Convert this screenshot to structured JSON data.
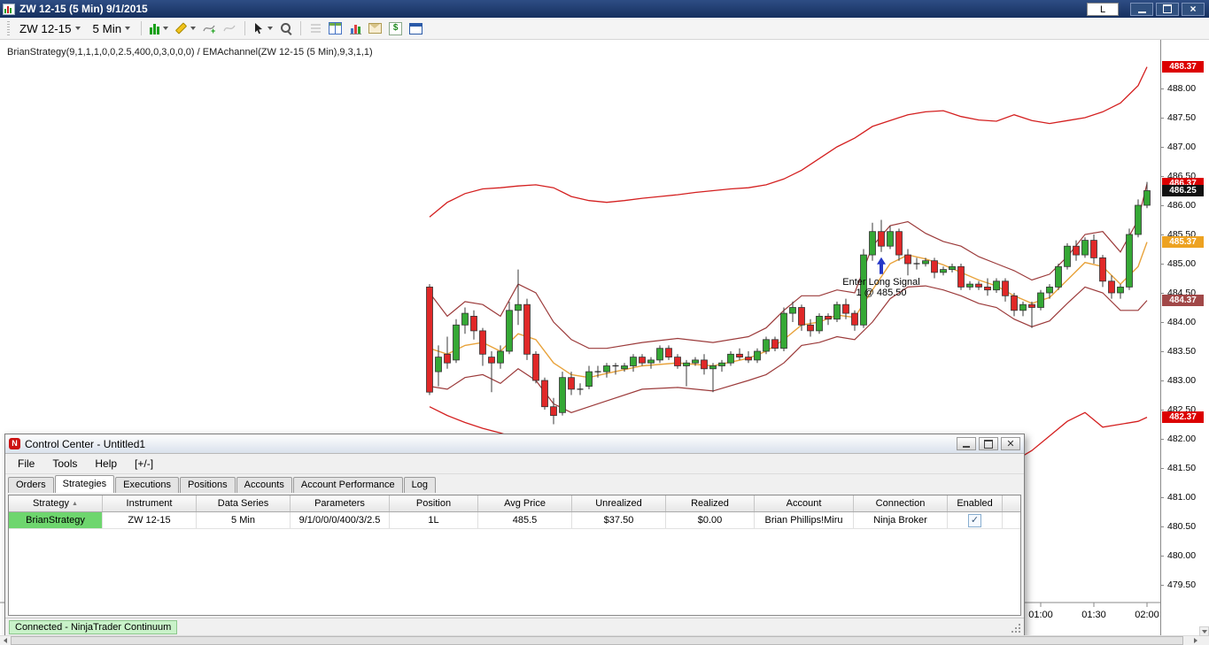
{
  "title_bar": {
    "title": "ZW 12-15 (5 Min)  9/1/2015",
    "link_button": "L"
  },
  "toolbar": {
    "instrument": "ZW 12-15",
    "interval": "5 Min"
  },
  "chart": {
    "indicator_label": "BrianStrategy(9,1,1,1,0,0,2.5,400,0,3,0,0,0) / EMAchannel(ZW 12-15 (5 Min),9,3,1,1)",
    "time_labels": [
      "01:00",
      "01:30",
      "02:00"
    ]
  },
  "chart_data": {
    "type": "candlestick",
    "instrument": "ZW 12-15",
    "interval": "5 Min",
    "price_axis": {
      "min": 479.5,
      "max": 488.0,
      "step": 0.5
    },
    "time_ticks": [
      {
        "label": "01:00",
        "bar": 69
      },
      {
        "label": "01:30",
        "bar": 75
      },
      {
        "label": "02:00",
        "bar": 81
      }
    ],
    "colors": {
      "up": "#35a835",
      "down": "#e02828",
      "band": "#d42020",
      "channel": "#9c3b3b",
      "ema": "#e8a33c",
      "signal_arrow": "#2638c8"
    },
    "signal": {
      "bar": 51,
      "price": 485.5,
      "label": "Enter Long Signal",
      "detail": "1 @ 485.50"
    },
    "price_markers": [
      {
        "value": "488.37",
        "price": 488.37,
        "bg": "#dc0000",
        "fg": "#ffffff"
      },
      {
        "value": "486.37",
        "price": 486.37,
        "bg": "#dc0000",
        "fg": "#ffffff"
      },
      {
        "value": "486.25",
        "price": 486.25,
        "bg": "#111111",
        "fg": "#ffffff"
      },
      {
        "value": "485.37",
        "price": 485.37,
        "bg": "#eda221",
        "fg": "#ffffff"
      },
      {
        "value": "484.37",
        "price": 484.37,
        "bg": "#a14848",
        "fg": "#ffffff"
      },
      {
        "value": "482.37",
        "price": 482.37,
        "bg": "#dc0000",
        "fg": "#ffffff"
      }
    ],
    "candles": [
      [
        484.6,
        484.65,
        482.75,
        482.8
      ],
      [
        483.15,
        483.6,
        482.9,
        483.4
      ],
      [
        483.45,
        483.75,
        483.2,
        483.3
      ],
      [
        483.35,
        484.05,
        483.3,
        483.95
      ],
      [
        483.95,
        484.25,
        483.8,
        484.15
      ],
      [
        484.1,
        484.2,
        483.7,
        483.85
      ],
      [
        483.85,
        483.9,
        483.25,
        483.45
      ],
      [
        483.4,
        483.5,
        482.8,
        483.3
      ],
      [
        483.3,
        483.6,
        483.2,
        483.5
      ],
      [
        483.5,
        484.35,
        483.45,
        484.2
      ],
      [
        484.2,
        484.9,
        483.95,
        484.3
      ],
      [
        484.3,
        484.4,
        483.35,
        483.45
      ],
      [
        483.45,
        483.5,
        482.95,
        483.0
      ],
      [
        483.0,
        483.05,
        482.5,
        482.55
      ],
      [
        482.55,
        482.7,
        482.25,
        482.4
      ],
      [
        482.45,
        483.15,
        482.4,
        483.05
      ],
      [
        483.05,
        483.15,
        482.75,
        482.85
      ],
      [
        482.85,
        482.95,
        482.75,
        482.85
      ],
      [
        482.9,
        483.25,
        482.85,
        483.15
      ],
      [
        483.15,
        483.25,
        483.05,
        483.15
      ],
      [
        483.15,
        483.3,
        483.05,
        483.25
      ],
      [
        483.25,
        483.3,
        483.1,
        483.25
      ],
      [
        483.2,
        483.3,
        483.15,
        483.25
      ],
      [
        483.25,
        483.45,
        483.15,
        483.4
      ],
      [
        483.4,
        483.45,
        483.25,
        483.3
      ],
      [
        483.3,
        483.4,
        483.2,
        483.35
      ],
      [
        483.35,
        483.6,
        483.3,
        483.55
      ],
      [
        483.55,
        483.6,
        483.35,
        483.4
      ],
      [
        483.4,
        483.45,
        483.2,
        483.25
      ],
      [
        483.25,
        483.35,
        482.9,
        483.3
      ],
      [
        483.3,
        483.4,
        483.25,
        483.35
      ],
      [
        483.35,
        483.45,
        483.1,
        483.2
      ],
      [
        483.2,
        483.3,
        482.8,
        483.25
      ],
      [
        483.25,
        483.35,
        483.15,
        483.3
      ],
      [
        483.3,
        483.5,
        483.25,
        483.45
      ],
      [
        483.45,
        483.55,
        483.35,
        483.4
      ],
      [
        483.4,
        483.5,
        483.3,
        483.35
      ],
      [
        483.35,
        483.55,
        483.3,
        483.5
      ],
      [
        483.5,
        483.75,
        483.45,
        483.7
      ],
      [
        483.7,
        483.75,
        483.5,
        483.55
      ],
      [
        483.55,
        484.25,
        483.5,
        484.15
      ],
      [
        484.15,
        484.35,
        484.0,
        484.25
      ],
      [
        484.25,
        484.3,
        483.85,
        483.95
      ],
      [
        483.95,
        484.05,
        483.75,
        483.85
      ],
      [
        483.85,
        484.15,
        483.8,
        484.1
      ],
      [
        484.1,
        484.15,
        483.95,
        484.05
      ],
      [
        484.05,
        484.35,
        484.0,
        484.3
      ],
      [
        484.3,
        484.4,
        484.05,
        484.15
      ],
      [
        484.15,
        484.2,
        483.85,
        483.95
      ],
      [
        483.95,
        485.25,
        483.9,
        485.15
      ],
      [
        485.15,
        485.7,
        485.05,
        485.55
      ],
      [
        485.55,
        485.75,
        485.2,
        485.3
      ],
      [
        485.3,
        485.65,
        485.25,
        485.55
      ],
      [
        485.55,
        485.6,
        485.05,
        485.15
      ],
      [
        485.15,
        485.25,
        484.8,
        485.0
      ],
      [
        485.0,
        485.1,
        484.9,
        485.0
      ],
      [
        485.0,
        485.1,
        484.95,
        485.05
      ],
      [
        485.05,
        485.1,
        484.75,
        484.85
      ],
      [
        484.85,
        484.95,
        484.8,
        484.9
      ],
      [
        484.9,
        485.0,
        484.85,
        484.95
      ],
      [
        484.95,
        485.0,
        484.55,
        484.6
      ],
      [
        484.6,
        484.7,
        484.55,
        484.65
      ],
      [
        484.65,
        484.7,
        484.55,
        484.6
      ],
      [
        484.6,
        484.75,
        484.45,
        484.55
      ],
      [
        484.55,
        484.75,
        484.5,
        484.7
      ],
      [
        484.7,
        484.75,
        484.35,
        484.45
      ],
      [
        484.45,
        484.5,
        484.1,
        484.2
      ],
      [
        484.2,
        484.35,
        484.1,
        484.3
      ],
      [
        484.3,
        484.35,
        483.9,
        484.25
      ],
      [
        484.25,
        484.55,
        484.2,
        484.5
      ],
      [
        484.5,
        484.65,
        484.4,
        484.6
      ],
      [
        484.6,
        485.0,
        484.55,
        484.95
      ],
      [
        484.95,
        485.35,
        484.9,
        485.3
      ],
      [
        485.3,
        485.4,
        485.05,
        485.15
      ],
      [
        485.15,
        485.45,
        485.1,
        485.4
      ],
      [
        485.4,
        485.5,
        485.0,
        485.1
      ],
      [
        485.1,
        485.15,
        484.6,
        484.7
      ],
      [
        484.7,
        484.8,
        484.4,
        484.5
      ],
      [
        484.5,
        484.65,
        484.4,
        484.6
      ],
      [
        484.6,
        485.6,
        484.55,
        485.5
      ],
      [
        485.5,
        486.1,
        485.45,
        486.0
      ],
      [
        486.0,
        486.4,
        485.95,
        486.25
      ]
    ],
    "overlays": {
      "ema_mid": [
        [
          0,
          483.55
        ],
        [
          2,
          483.45
        ],
        [
          4,
          483.6
        ],
        [
          6,
          483.65
        ],
        [
          8,
          483.5
        ],
        [
          10,
          483.8
        ],
        [
          12,
          483.7
        ],
        [
          14,
          483.3
        ],
        [
          16,
          483.1
        ],
        [
          18,
          483.05
        ],
        [
          20,
          483.12
        ],
        [
          24,
          483.25
        ],
        [
          28,
          483.3
        ],
        [
          32,
          483.25
        ],
        [
          36,
          483.38
        ],
        [
          38,
          483.5
        ],
        [
          40,
          483.7
        ],
        [
          42,
          483.95
        ],
        [
          44,
          484.0
        ],
        [
          46,
          484.12
        ],
        [
          48,
          484.08
        ],
        [
          50,
          484.55
        ],
        [
          52,
          485.0
        ],
        [
          54,
          485.15
        ],
        [
          56,
          485.08
        ],
        [
          58,
          484.98
        ],
        [
          60,
          484.85
        ],
        [
          62,
          484.72
        ],
        [
          64,
          484.62
        ],
        [
          66,
          484.45
        ],
        [
          68,
          484.32
        ],
        [
          70,
          484.42
        ],
        [
          72,
          484.72
        ],
        [
          74,
          485.02
        ],
        [
          76,
          484.95
        ],
        [
          78,
          484.65
        ],
        [
          80,
          484.95
        ],
        [
          81,
          485.37
        ]
      ],
      "channel_upper": [
        [
          0,
          484.5
        ],
        [
          2,
          484.1
        ],
        [
          4,
          484.35
        ],
        [
          6,
          484.3
        ],
        [
          8,
          484.1
        ],
        [
          10,
          484.65
        ],
        [
          12,
          484.5
        ],
        [
          14,
          484.0
        ],
        [
          16,
          483.7
        ],
        [
          18,
          483.55
        ],
        [
          20,
          483.55
        ],
        [
          24,
          483.65
        ],
        [
          28,
          483.72
        ],
        [
          32,
          483.65
        ],
        [
          36,
          483.75
        ],
        [
          38,
          483.9
        ],
        [
          40,
          484.2
        ],
        [
          42,
          484.45
        ],
        [
          44,
          484.45
        ],
        [
          46,
          484.55
        ],
        [
          48,
          484.5
        ],
        [
          50,
          485.3
        ],
        [
          52,
          485.65
        ],
        [
          54,
          485.72
        ],
        [
          56,
          485.52
        ],
        [
          58,
          485.38
        ],
        [
          60,
          485.3
        ],
        [
          62,
          485.12
        ],
        [
          64,
          485.0
        ],
        [
          66,
          484.88
        ],
        [
          68,
          484.72
        ],
        [
          70,
          484.82
        ],
        [
          72,
          485.12
        ],
        [
          74,
          485.5
        ],
        [
          76,
          485.55
        ],
        [
          78,
          485.2
        ],
        [
          80,
          485.75
        ],
        [
          81,
          486.37
        ]
      ],
      "channel_lower": [
        [
          0,
          482.9
        ],
        [
          2,
          482.85
        ],
        [
          4,
          483.05
        ],
        [
          6,
          483.1
        ],
        [
          8,
          482.95
        ],
        [
          10,
          483.2
        ],
        [
          12,
          483.0
        ],
        [
          14,
          482.6
        ],
        [
          16,
          482.45
        ],
        [
          18,
          482.55
        ],
        [
          20,
          482.65
        ],
        [
          24,
          482.85
        ],
        [
          28,
          482.88
        ],
        [
          32,
          482.82
        ],
        [
          36,
          483.0
        ],
        [
          38,
          483.1
        ],
        [
          40,
          483.3
        ],
        [
          42,
          483.6
        ],
        [
          44,
          483.65
        ],
        [
          46,
          483.75
        ],
        [
          48,
          483.7
        ],
        [
          50,
          484.0
        ],
        [
          52,
          484.4
        ],
        [
          54,
          484.6
        ],
        [
          56,
          484.62
        ],
        [
          58,
          484.55
        ],
        [
          60,
          484.45
        ],
        [
          62,
          484.32
        ],
        [
          64,
          484.25
        ],
        [
          66,
          484.05
        ],
        [
          68,
          483.92
        ],
        [
          70,
          484.02
        ],
        [
          72,
          484.32
        ],
        [
          74,
          484.6
        ],
        [
          76,
          484.5
        ],
        [
          78,
          484.2
        ],
        [
          80,
          484.2
        ],
        [
          81,
          484.37
        ]
      ],
      "band_upper": [
        [
          0,
          485.8
        ],
        [
          2,
          486.05
        ],
        [
          4,
          486.2
        ],
        [
          6,
          486.28
        ],
        [
          8,
          486.3
        ],
        [
          10,
          486.33
        ],
        [
          12,
          486.35
        ],
        [
          14,
          486.3
        ],
        [
          16,
          486.15
        ],
        [
          18,
          486.08
        ],
        [
          20,
          486.05
        ],
        [
          22,
          486.08
        ],
        [
          24,
          486.12
        ],
        [
          26,
          486.15
        ],
        [
          28,
          486.18
        ],
        [
          30,
          486.22
        ],
        [
          32,
          486.25
        ],
        [
          34,
          486.28
        ],
        [
          36,
          486.3
        ],
        [
          38,
          486.35
        ],
        [
          40,
          486.45
        ],
        [
          42,
          486.6
        ],
        [
          44,
          486.8
        ],
        [
          46,
          487.0
        ],
        [
          48,
          487.15
        ],
        [
          50,
          487.35
        ],
        [
          52,
          487.45
        ],
        [
          54,
          487.55
        ],
        [
          56,
          487.6
        ],
        [
          58,
          487.62
        ],
        [
          60,
          487.52
        ],
        [
          62,
          487.46
        ],
        [
          64,
          487.44
        ],
        [
          66,
          487.55
        ],
        [
          68,
          487.45
        ],
        [
          70,
          487.4
        ],
        [
          72,
          487.45
        ],
        [
          74,
          487.5
        ],
        [
          76,
          487.6
        ],
        [
          78,
          487.75
        ],
        [
          80,
          488.05
        ],
        [
          81,
          488.37
        ]
      ],
      "band_lower": [
        [
          0,
          482.55
        ],
        [
          2,
          482.4
        ],
        [
          4,
          482.28
        ],
        [
          6,
          482.18
        ],
        [
          8,
          482.1
        ],
        [
          10,
          482.0
        ],
        [
          12,
          481.9
        ],
        [
          14,
          481.78
        ],
        [
          16,
          481.85
        ],
        [
          18,
          481.92
        ],
        [
          20,
          481.98
        ],
        [
          24,
          482.0
        ],
        [
          28,
          481.95
        ],
        [
          32,
          481.92
        ],
        [
          36,
          481.88
        ],
        [
          40,
          481.8
        ],
        [
          44,
          481.65
        ],
        [
          48,
          481.55
        ],
        [
          52,
          481.48
        ],
        [
          56,
          481.45
        ],
        [
          60,
          481.52
        ],
        [
          64,
          481.58
        ],
        [
          66,
          481.62
        ],
        [
          68,
          481.8
        ],
        [
          70,
          482.05
        ],
        [
          72,
          482.3
        ],
        [
          74,
          482.45
        ],
        [
          76,
          482.2
        ],
        [
          78,
          482.25
        ],
        [
          80,
          482.3
        ],
        [
          81,
          482.37
        ]
      ]
    }
  },
  "control_center": {
    "title": "Control Center - Untitled1",
    "menu": [
      "File",
      "Tools",
      "Help",
      "[+/-]"
    ],
    "tabs": [
      "Orders",
      "Strategies",
      "Executions",
      "Positions",
      "Accounts",
      "Account Performance",
      "Log"
    ],
    "active_tab": "Strategies",
    "table": {
      "columns": [
        "Strategy",
        "Instrument",
        "Data Series",
        "Parameters",
        "Position",
        "Avg Price",
        "Unrealized",
        "Realized",
        "Account",
        "Connection",
        "Enabled"
      ],
      "row": {
        "values": [
          "BrianStrategy",
          "ZW 12-15",
          "5 Min",
          "9/1/0/0/0/400/3/2.5",
          "1L",
          "485.5",
          "$37.50",
          "$0.00",
          "Brian Phillips!Miru",
          "Ninja Broker"
        ],
        "enabled": true
      }
    },
    "status": "Connected - NinjaTrader Continuum"
  }
}
